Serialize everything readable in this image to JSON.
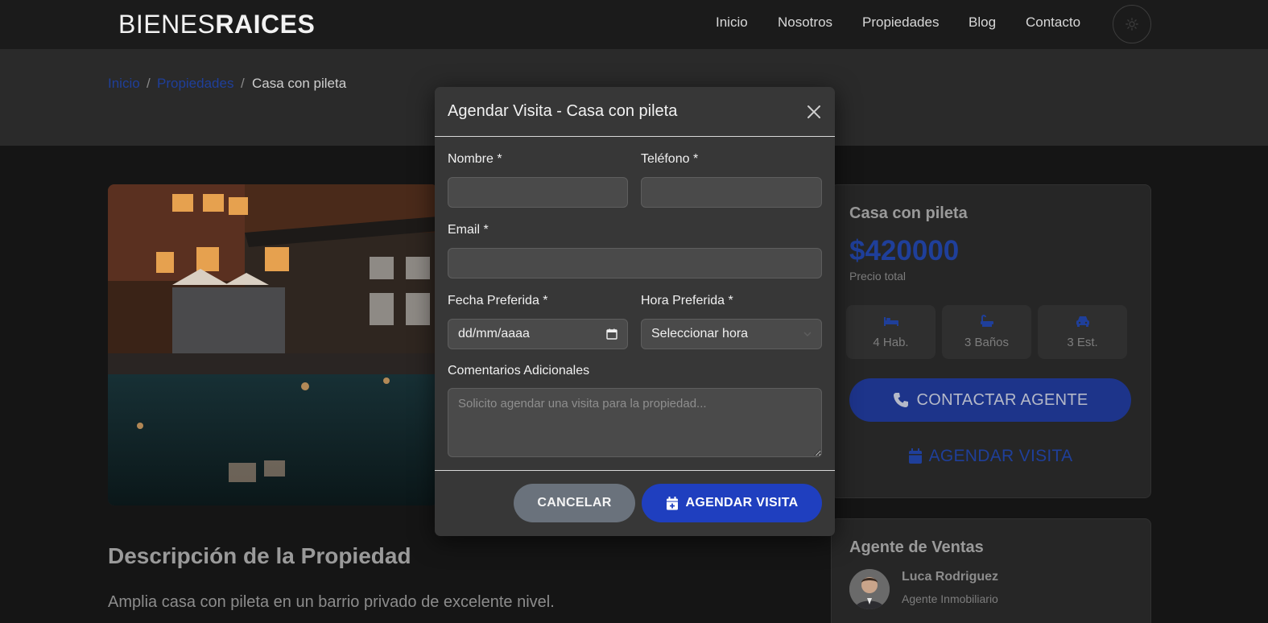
{
  "header": {
    "logo_thin": "BIENES",
    "logo_bold": "RAICES",
    "nav": [
      "Inicio",
      "Nosotros",
      "Propiedades",
      "Blog",
      "Contacto"
    ],
    "theme_icon": "sun-icon"
  },
  "breadcrumb": {
    "items": [
      "Inicio",
      "Propiedades",
      "Casa con pileta"
    ],
    "separator": "/"
  },
  "property": {
    "description_title": "Descripción de la Propiedad",
    "description_text": "Amplia casa con pileta en un barrio privado de excelente nivel."
  },
  "summary_card": {
    "title": "Casa con pileta",
    "price": "$420000",
    "price_label": "Precio total",
    "features": [
      {
        "icon": "bed-icon",
        "label": "4 Hab."
      },
      {
        "icon": "bath-icon",
        "label": "3 Baños"
      },
      {
        "icon": "car-icon",
        "label": "3 Est."
      }
    ],
    "contact_button": "CONTACTAR AGENTE",
    "visit_button": "AGENDAR VISITA"
  },
  "agent_card": {
    "title": "Agente de Ventas",
    "name": "Luca Rodriguez",
    "role": "Agente Inmobiliario"
  },
  "modal": {
    "title": "Agendar Visita - Casa con pileta",
    "labels": {
      "name": "Nombre *",
      "phone": "Teléfono *",
      "email": "Email *",
      "date": "Fecha Preferida *",
      "time": "Hora Preferida *",
      "comments": "Comentarios Adicionales"
    },
    "values": {
      "name": "",
      "phone": "",
      "email": ""
    },
    "date_placeholder": "dd/mm/aaaa",
    "time_placeholder": "Seleccionar hora",
    "comments_placeholder": "Solicito agendar una visita para la propiedad...",
    "cancel_button": "CANCELAR",
    "submit_button": "AGENDAR VISITA"
  },
  "colors": {
    "accent": "#1f3fbf",
    "accent_dim": "#1f3f9a",
    "modal_bg": "#373737",
    "page_bg": "#151515"
  }
}
